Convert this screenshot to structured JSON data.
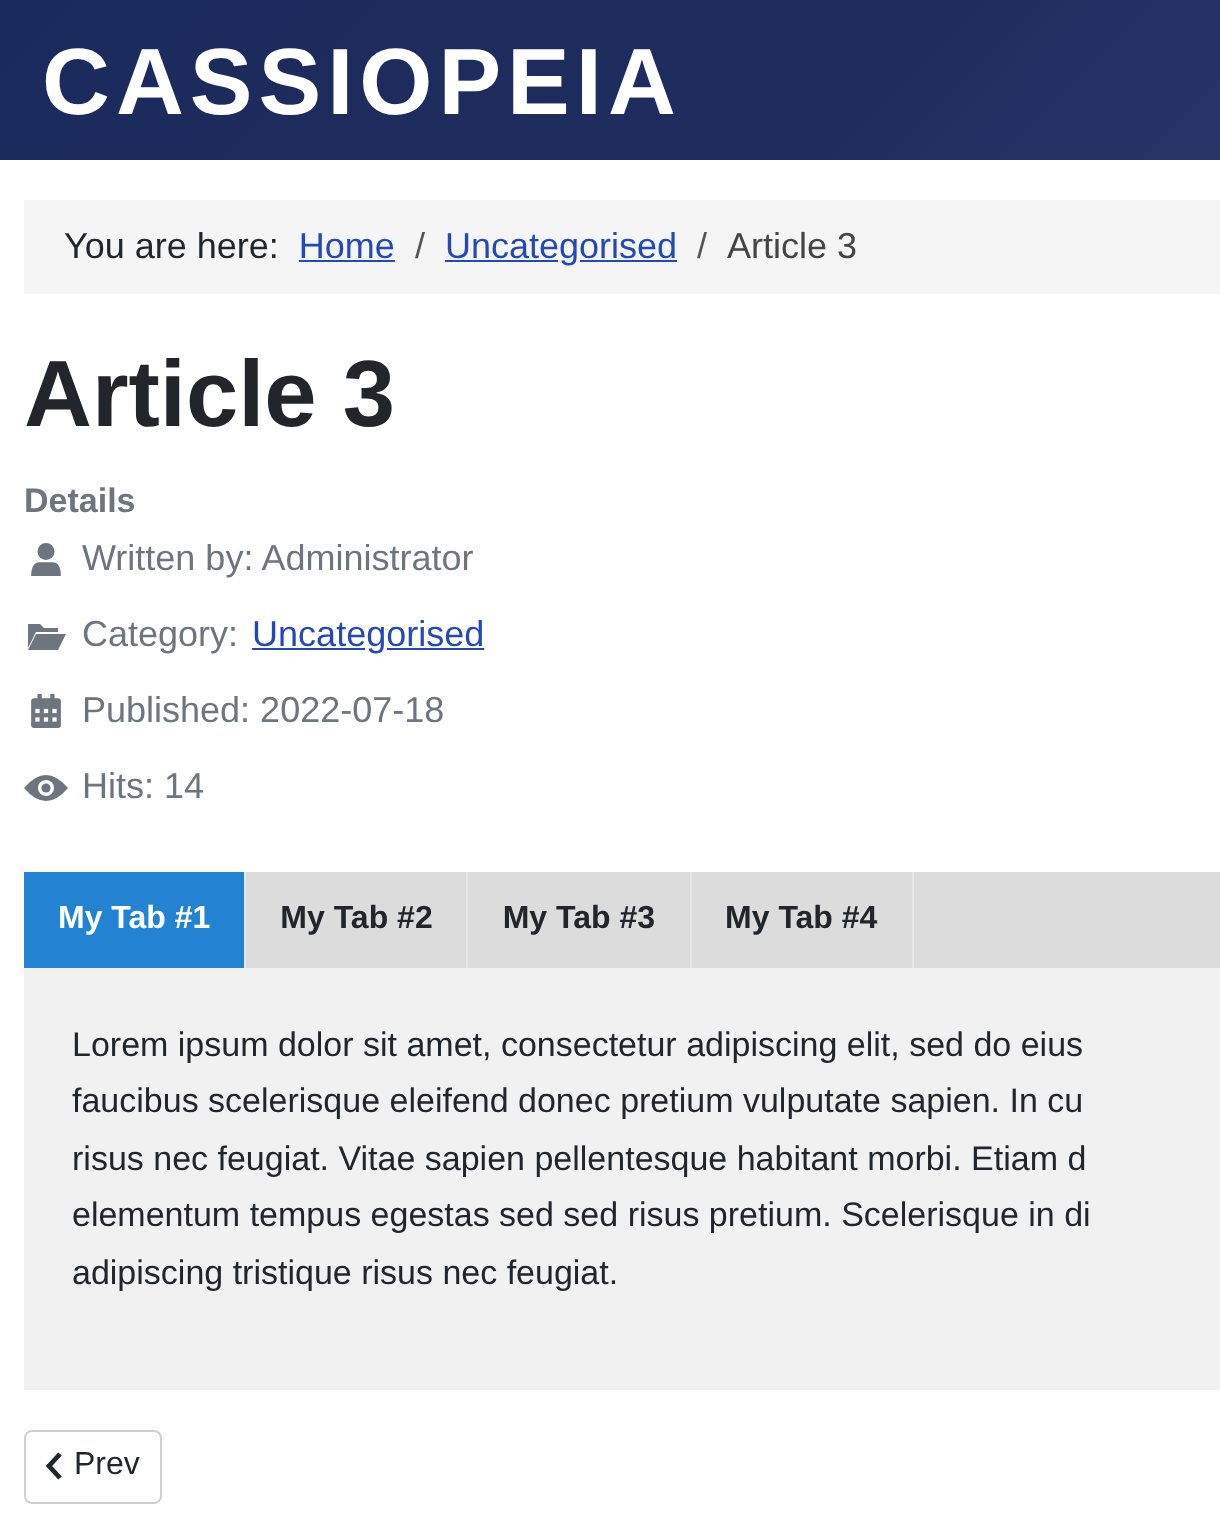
{
  "header": {
    "brand": "CASSIOPEIA"
  },
  "breadcrumb": {
    "label": "You are here:",
    "items": [
      {
        "text": "Home",
        "kind": "link"
      },
      {
        "text": "Uncategorised",
        "kind": "link"
      },
      {
        "text": "Article 3",
        "kind": "current"
      }
    ],
    "separator": "/"
  },
  "article": {
    "title": "Article 3",
    "details_heading": "Details",
    "meta": [
      {
        "kind": "author",
        "label": "Written by: Administrator"
      },
      {
        "kind": "category",
        "label": "Category:",
        "link": "Uncategorised"
      },
      {
        "kind": "published",
        "label": "Published: 2022-07-18"
      },
      {
        "kind": "hits",
        "label": "Hits: 14"
      }
    ]
  },
  "tabs": [
    {
      "label": "My Tab #1",
      "selected": true
    },
    {
      "label": "My Tab #2",
      "selected": false
    },
    {
      "label": "My Tab #3",
      "selected": false
    },
    {
      "label": "My Tab #4",
      "selected": false
    }
  ],
  "tab_panel": {
    "lines": [
      "Lorem ipsum dolor sit amet, consectetur adipiscing elit, sed do eius",
      "faucibus scelerisque eleifend donec pretium vulputate sapien. In cu",
      "risus nec feugiat. Vitae sapien pellentesque habitant morbi. Etiam d",
      "elementum tempus egestas sed sed risus pretium. Scelerisque in di",
      "adipiscing tristique risus nec feugiat."
    ]
  },
  "pagination": {
    "prev": "Prev"
  }
}
